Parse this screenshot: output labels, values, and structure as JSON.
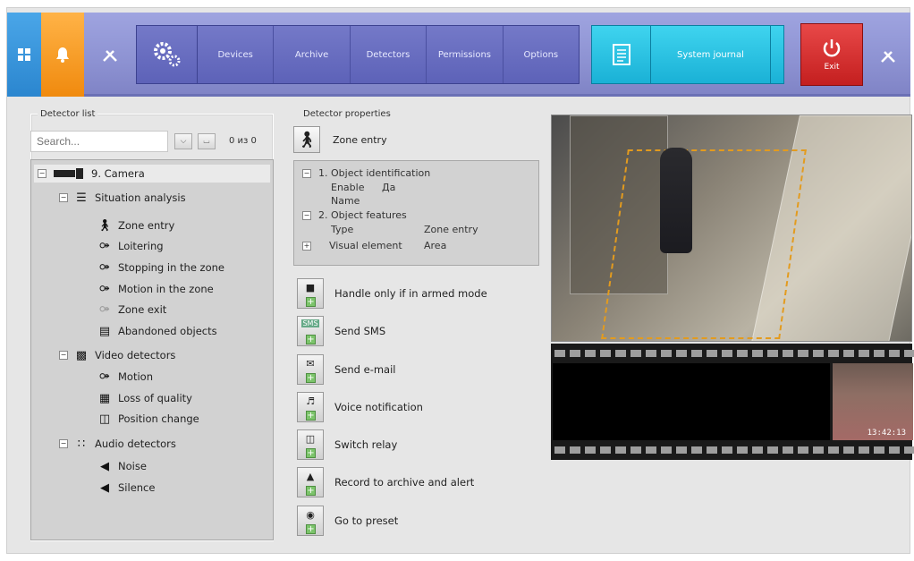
{
  "nav": {
    "devices": "Devices",
    "archive": "Archive",
    "detectors": "Detectors",
    "permissions": "Permissions",
    "options": "Options",
    "journal": "System journal",
    "exit": "Exit"
  },
  "detector_list": {
    "title": "Detector list",
    "search_placeholder": "Search...",
    "count": "0 из 0",
    "tree": {
      "camera": "9. Camera",
      "situation": "Situation analysis",
      "zone_entry": "Zone entry",
      "loitering": "Loitering",
      "stopping": "Stopping in the zone",
      "motion_zone": "Motion in the zone",
      "zone_exit": "Zone exit",
      "abandoned": "Abandoned objects",
      "video": "Video detectors",
      "motion": "Motion",
      "loss": "Loss of quality",
      "position": "Position change",
      "audio": "Audio detectors",
      "noise": "Noise",
      "silence": "Silence"
    }
  },
  "properties": {
    "title": "Detector properties",
    "selected": "Zone entry",
    "obj_ident": "1. Object identification",
    "enable_label": "Enable",
    "enable_value": "Да",
    "name_label": "Name",
    "obj_features": "2. Object features",
    "type_label": "Type",
    "type_value": "Zone entry",
    "visual_label": "Visual element",
    "visual_value": "Area"
  },
  "actions": {
    "armed": "Handle only if in armed mode",
    "sms": "Send SMS",
    "email": "Send e-mail",
    "voice": "Voice notification",
    "relay": "Switch relay",
    "record": "Record to archive and alert",
    "preset": "Go to preset",
    "sms_icon": "SMS"
  },
  "video": {
    "timestamp": "13:42:13"
  },
  "colors": {
    "topbar": "#8d92d2",
    "apps_tile": "#2b86cf",
    "bell_tile": "#f08a0e",
    "journal": "#1ab1d6",
    "exit": "#c41f1f",
    "zone": "#e39b1e"
  }
}
